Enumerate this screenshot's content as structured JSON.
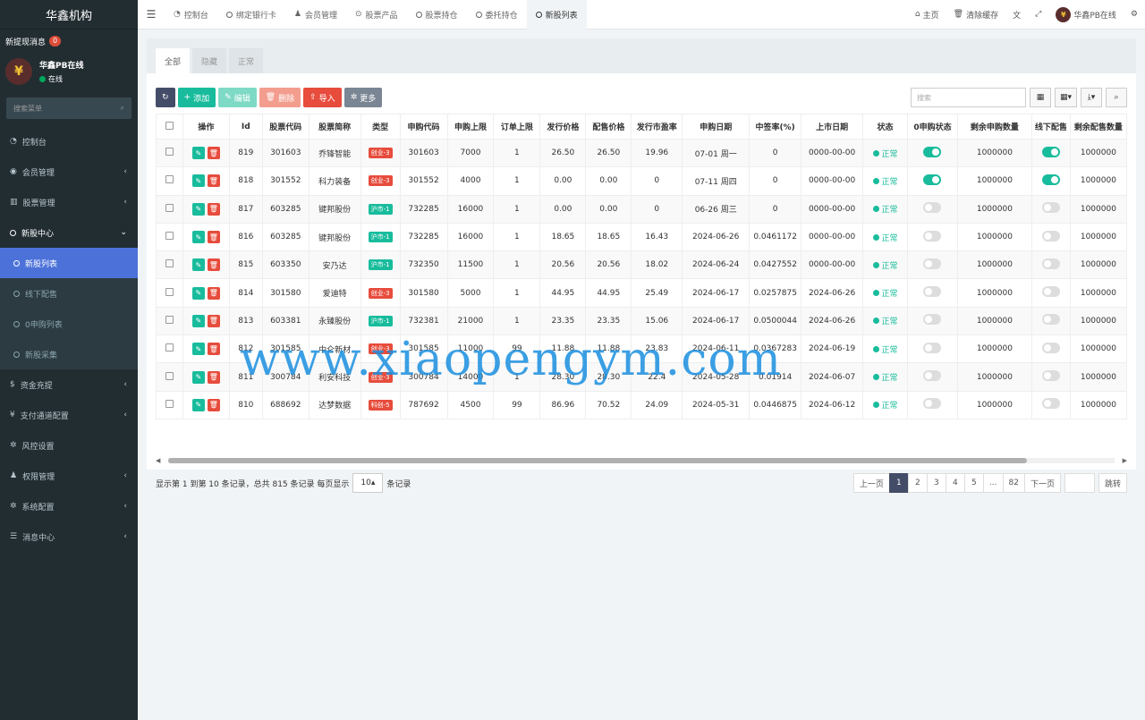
{
  "sidebar": {
    "logo": "华鑫机构",
    "notice": "新提现消息",
    "notice_count": "0",
    "user_name": "华鑫PB在线",
    "user_status": "在线",
    "search_placeholder": "搜索菜单",
    "menu": [
      "控制台",
      "会员管理",
      "股票管理",
      "新股中心",
      "新股列表",
      "线下配售",
      "0申购列表",
      "新股采集",
      "资金充提",
      "支付通道配置",
      "风控设置",
      "权限管理",
      "系统配置",
      "消息中心"
    ]
  },
  "topbar": {
    "tabs": [
      "控制台",
      "绑定银行卡",
      "会员管理",
      "股票产品",
      "股票持仓",
      "委托持仓",
      "新股列表"
    ],
    "home": "主页",
    "clear_cache": "清除缓存",
    "user": "华鑫PB在线"
  },
  "panel": {
    "tabs": [
      "全部",
      "隐藏",
      "正常"
    ],
    "buttons": {
      "add": "添加",
      "edit": "编辑",
      "delete": "删除",
      "import": "导入",
      "more": "更多"
    },
    "search_placeholder": "搜索",
    "columns": [
      "操作",
      "Id",
      "股票代码",
      "股票简称",
      "类型",
      "申购代码",
      "申购上限",
      "订单上限",
      "发行价格",
      "配售价格",
      "发行市盈率",
      "申购日期",
      "中签率(%)",
      "上市日期",
      "状态",
      "0申购状态",
      "剩余申购数量",
      "线下配售",
      "剩余配售数量"
    ],
    "rows": [
      {
        "id": "819",
        "code": "301603",
        "name": "乔锋智能",
        "type": "创业-3",
        "type_color": "red",
        "sub_code": "301603",
        "sub_limit": "7000",
        "order_limit": "1",
        "price": "26.50",
        "alloc_price": "26.50",
        "pe": "19.96",
        "date": "07-01 周一",
        "rate": "0",
        "list_date": "0000-00-00",
        "status": "正常",
        "zero_on": true,
        "remain": "1000000",
        "offline_on": true,
        "remain_alloc": "1000000"
      },
      {
        "id": "818",
        "code": "301552",
        "name": "科力装备",
        "type": "创业-3",
        "type_color": "red",
        "sub_code": "301552",
        "sub_limit": "4000",
        "order_limit": "1",
        "price": "0.00",
        "alloc_price": "0.00",
        "pe": "0",
        "date": "07-11 周四",
        "rate": "0",
        "list_date": "0000-00-00",
        "status": "正常",
        "zero_on": true,
        "remain": "1000000",
        "offline_on": true,
        "remain_alloc": "1000000"
      },
      {
        "id": "817",
        "code": "603285",
        "name": "键邦股份",
        "type": "沪市-1",
        "type_color": "green",
        "sub_code": "732285",
        "sub_limit": "16000",
        "order_limit": "1",
        "price": "0.00",
        "alloc_price": "0.00",
        "pe": "0",
        "date": "06-26 周三",
        "rate": "0",
        "list_date": "0000-00-00",
        "status": "正常",
        "zero_on": false,
        "remain": "1000000",
        "offline_on": false,
        "remain_alloc": "1000000"
      },
      {
        "id": "816",
        "code": "603285",
        "name": "键邦股份",
        "type": "沪市-1",
        "type_color": "green",
        "sub_code": "732285",
        "sub_limit": "16000",
        "order_limit": "1",
        "price": "18.65",
        "alloc_price": "18.65",
        "pe": "16.43",
        "date": "2024-06-26",
        "rate": "0.0461172",
        "list_date": "0000-00-00",
        "status": "正常",
        "zero_on": false,
        "remain": "1000000",
        "offline_on": false,
        "remain_alloc": "1000000"
      },
      {
        "id": "815",
        "code": "603350",
        "name": "安乃达",
        "type": "沪市-1",
        "type_color": "green",
        "sub_code": "732350",
        "sub_limit": "11500",
        "order_limit": "1",
        "price": "20.56",
        "alloc_price": "20.56",
        "pe": "18.02",
        "date": "2024-06-24",
        "rate": "0.0427552",
        "list_date": "0000-00-00",
        "status": "正常",
        "zero_on": false,
        "remain": "1000000",
        "offline_on": false,
        "remain_alloc": "1000000"
      },
      {
        "id": "814",
        "code": "301580",
        "name": "爱迪特",
        "type": "创业-3",
        "type_color": "red",
        "sub_code": "301580",
        "sub_limit": "5000",
        "order_limit": "1",
        "price": "44.95",
        "alloc_price": "44.95",
        "pe": "25.49",
        "date": "2024-06-17",
        "rate": "0.0257875",
        "list_date": "2024-06-26",
        "status": "正常",
        "zero_on": false,
        "remain": "1000000",
        "offline_on": false,
        "remain_alloc": "1000000"
      },
      {
        "id": "813",
        "code": "603381",
        "name": "永臻股份",
        "type": "沪市-1",
        "type_color": "green",
        "sub_code": "732381",
        "sub_limit": "21000",
        "order_limit": "1",
        "price": "23.35",
        "alloc_price": "23.35",
        "pe": "15.06",
        "date": "2024-06-17",
        "rate": "0.0500044",
        "list_date": "2024-06-26",
        "status": "正常",
        "zero_on": false,
        "remain": "1000000",
        "offline_on": false,
        "remain_alloc": "1000000"
      },
      {
        "id": "812",
        "code": "301585",
        "name": "中仑新材",
        "type": "创业-3",
        "type_color": "red",
        "sub_code": "301585",
        "sub_limit": "11000",
        "order_limit": "99",
        "price": "11.88",
        "alloc_price": "11.88",
        "pe": "23.83",
        "date": "2024-06-11",
        "rate": "0.0367283",
        "list_date": "2024-06-19",
        "status": "正常",
        "zero_on": false,
        "remain": "1000000",
        "offline_on": false,
        "remain_alloc": "1000000"
      },
      {
        "id": "811",
        "code": "300784",
        "name": "利安科技",
        "type": "创业-3",
        "type_color": "red",
        "sub_code": "300784",
        "sub_limit": "14000",
        "order_limit": "1",
        "price": "28.30",
        "alloc_price": "28.30",
        "pe": "22.4",
        "date": "2024-05-28",
        "rate": "0.01914",
        "list_date": "2024-06-07",
        "status": "正常",
        "zero_on": false,
        "remain": "1000000",
        "offline_on": false,
        "remain_alloc": "1000000"
      },
      {
        "id": "810",
        "code": "688692",
        "name": "达梦数据",
        "type": "科创-5",
        "type_color": "red",
        "sub_code": "787692",
        "sub_limit": "4500",
        "order_limit": "99",
        "price": "86.96",
        "alloc_price": "70.52",
        "pe": "24.09",
        "date": "2024-05-31",
        "rate": "0.0446875",
        "list_date": "2024-06-12",
        "status": "正常",
        "zero_on": false,
        "remain": "1000000",
        "offline_on": false,
        "remain_alloc": "1000000"
      }
    ],
    "footer_text": "显示第 1 到第 10 条记录，总共 815 条记录 每页显示",
    "page_size": "10",
    "footer_suffix": "条记录",
    "pager": [
      "上一页",
      "1",
      "2",
      "3",
      "4",
      "5",
      "...",
      "82",
      "下一页"
    ],
    "go": "跳转"
  },
  "watermark": "www.xiaopengym.com",
  "colors": {
    "sidebar_bg": "#222d32",
    "active_menu": "#4c72d9",
    "success": "#18bc9c",
    "danger": "#e74c3c",
    "primary_dark": "#444d68"
  }
}
